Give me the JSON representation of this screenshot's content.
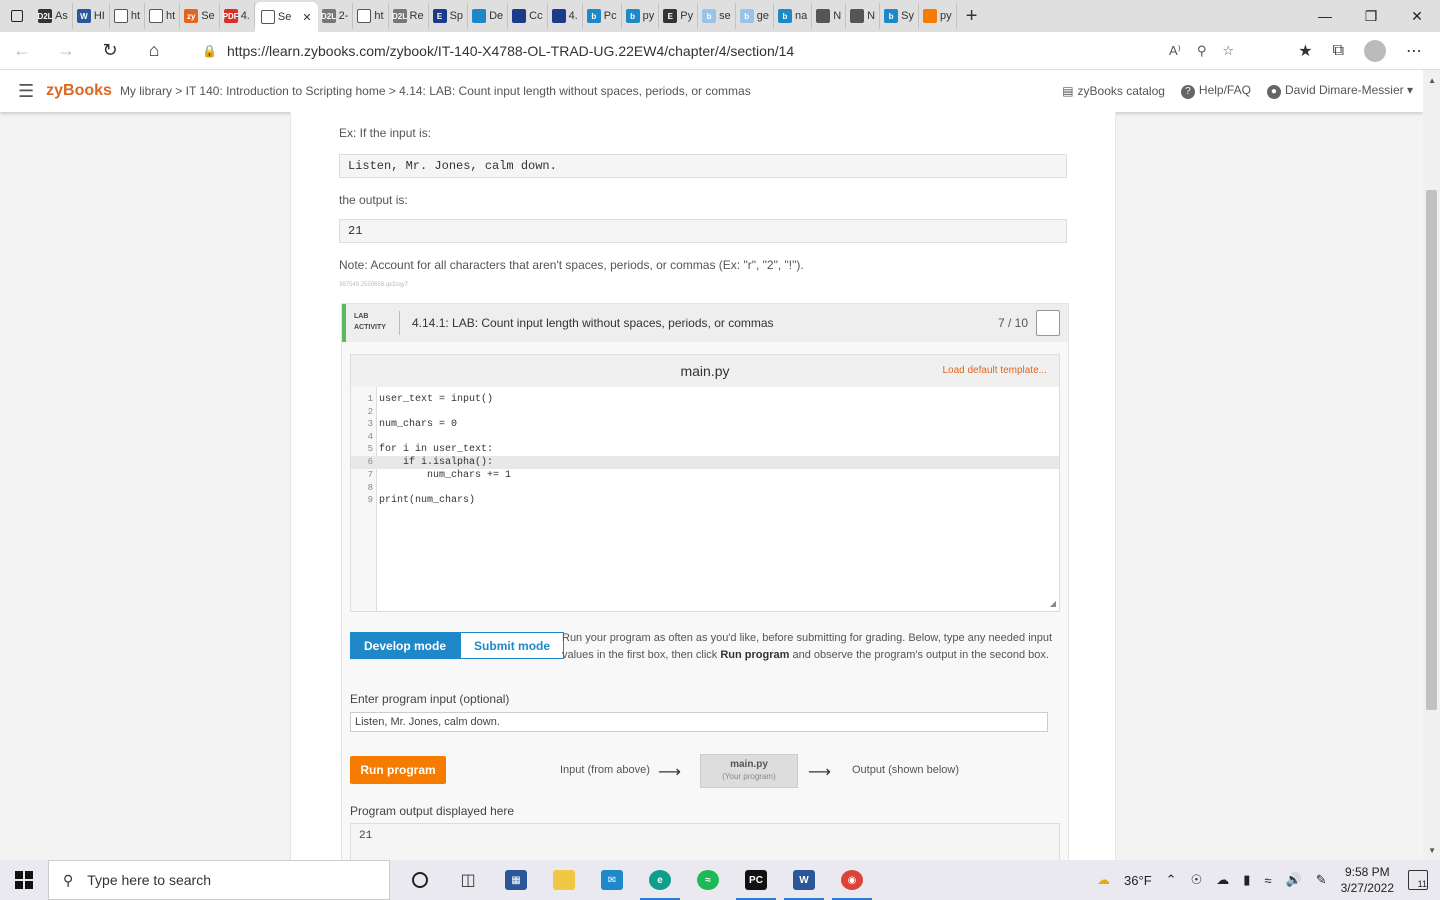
{
  "browser": {
    "tabs": [
      {
        "label": "As",
        "fav": "D2L",
        "color": "#333"
      },
      {
        "label": "HI",
        "fav": "W",
        "color": "#2b579a"
      },
      {
        "label": "ht",
        "fav": "",
        "color": "#fff"
      },
      {
        "label": "ht",
        "fav": "",
        "color": "#fff"
      },
      {
        "label": "Se",
        "fav": "zy",
        "color": "#e0661f"
      },
      {
        "label": "4.",
        "fav": "PDF",
        "color": "#d93025"
      },
      {
        "label": "Se",
        "fav": "",
        "color": "#fff",
        "active": true
      },
      {
        "label": "2-",
        "fav": "D2L",
        "color": "#777"
      },
      {
        "label": "ht",
        "fav": "",
        "color": "#fff"
      },
      {
        "label": "Re",
        "fav": "D2L",
        "color": "#777"
      },
      {
        "label": "Sp",
        "fav": "E",
        "color": "#1b3a8a"
      },
      {
        "label": "De",
        "fav": "",
        "color": "#1e88c9"
      },
      {
        "label": "Cc",
        "fav": "",
        "color": "#1b3a8a"
      },
      {
        "label": "4.",
        "fav": "",
        "color": "#1b3a8a"
      },
      {
        "label": "Pc",
        "fav": "b",
        "color": "#1e88c9"
      },
      {
        "label": "py",
        "fav": "b",
        "color": "#1e88c9"
      },
      {
        "label": "Py",
        "fav": "E",
        "color": "#333"
      },
      {
        "label": "se",
        "fav": "b",
        "color": "#9bc3e8"
      },
      {
        "label": "ge",
        "fav": "b",
        "color": "#9bc3e8"
      },
      {
        "label": "na",
        "fav": "b",
        "color": "#1e88c9"
      },
      {
        "label": "N",
        "fav": "",
        "color": "#555"
      },
      {
        "label": "N",
        "fav": "",
        "color": "#555"
      },
      {
        "label": "Sy",
        "fav": "b",
        "color": "#1e88c9"
      },
      {
        "label": "py",
        "fav": "",
        "color": "#f57c00"
      }
    ],
    "new_tab": "+",
    "url": "https://learn.zybooks.com/zybook/IT-140-X4788-OL-TRAD-UG.22EW4/chapter/4/section/14"
  },
  "header": {
    "logo": "zyBooks",
    "breadcrumb": "My library > IT 140: Introduction to Scripting home > 4.14: LAB: Count input length without spaces, periods, or commas",
    "catalog": "zyBooks catalog",
    "help": "Help/FAQ",
    "user": "David Dimare-Messier"
  },
  "content": {
    "ex_label": "Ex: If the input is:",
    "ex_input": "Listen, Mr. Jones, calm down.",
    "output_label": "the output is:",
    "ex_output": "21",
    "note": "Note: Account for all characters that aren't spaces, periods, or commas (Ex: \"r\", \"2\", \"!\").",
    "tiny_id": "387549.2550658.qx3zqy7"
  },
  "lab": {
    "tag_line1": "LAB",
    "tag_line2": "ACTIVITY",
    "title": "4.14.1: LAB: Count input length without spaces, periods, or commas",
    "score": "7 / 10",
    "filename": "main.py",
    "load_template": "Load default template...",
    "code": [
      {
        "n": "1",
        "t": "user_text = input()"
      },
      {
        "n": "2",
        "t": ""
      },
      {
        "n": "3",
        "t": "num_chars = 0"
      },
      {
        "n": "4",
        "t": ""
      },
      {
        "n": "5",
        "t": "for i in user_text:"
      },
      {
        "n": "6",
        "t": "    if i.isalpha():"
      },
      {
        "n": "7",
        "t": "        num_chars += 1"
      },
      {
        "n": "8",
        "t": ""
      },
      {
        "n": "9",
        "t": "print(num_chars)"
      }
    ],
    "develop_mode": "Develop mode",
    "submit_mode": "Submit mode",
    "mode_desc_1": "Run your program as often as you'd like, before submitting for grading. Below, type any needed input values in the first box, then click ",
    "mode_desc_bold": "Run program",
    "mode_desc_2": " and observe the program's output in the second box.",
    "input_label": "Enter program input (optional)",
    "input_value": "Listen, Mr. Jones, calm down.",
    "run_button": "Run program",
    "flow_input": "Input (from above)",
    "flow_program": "main.py",
    "flow_program_sub": "(Your program)",
    "flow_output": "Output (shown below)",
    "output_label": "Program output displayed here",
    "output_value": "21"
  },
  "taskbar": {
    "search_placeholder": "Type here to search",
    "weather": "36°F",
    "time": "9:58 PM",
    "date": "3/27/2022",
    "notifications": "11"
  }
}
